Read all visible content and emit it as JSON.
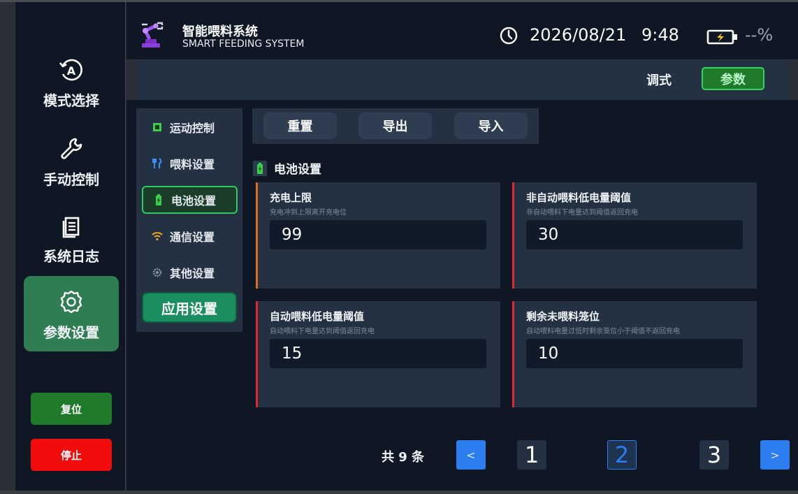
{
  "header": {
    "title": "智能喂料系统",
    "subtitle": "SMART FEEDING SYSTEM",
    "date": "2026/08/21",
    "time": "9:48",
    "battery": "--%"
  },
  "sidebar": {
    "items": [
      {
        "label": "模式选择",
        "icon": "mode-auto-icon"
      },
      {
        "label": "手动控制",
        "icon": "wrench-icon"
      },
      {
        "label": "系统日志",
        "icon": "log-file-icon"
      },
      {
        "label": "参数设置",
        "icon": "gear-icon"
      }
    ],
    "reset_label": "复位",
    "stop_label": "停止"
  },
  "modebar": {
    "debug_label": "调式",
    "param_label": "参数"
  },
  "subnav": {
    "items": [
      {
        "label": "运动控制",
        "icon": "chip-icon"
      },
      {
        "label": "喂料设置",
        "icon": "fork-knife-icon"
      },
      {
        "label": "电池设置",
        "icon": "battery-icon"
      },
      {
        "label": "通信设置",
        "icon": "wifi-icon"
      },
      {
        "label": "其他设置",
        "icon": "cog-icon"
      }
    ],
    "apply_label": "应用设置"
  },
  "toolbar": {
    "reset_label": "重置",
    "export_label": "导出",
    "import_label": "导入"
  },
  "section": {
    "title": "电池设置"
  },
  "cards": [
    {
      "title": "充电上限",
      "desc": "充电冲到上限离开充电位",
      "value": "99"
    },
    {
      "title": "非自动喂料低电量阈值",
      "desc": "非自动喂料下电量达到阈值返回充电",
      "value": "30"
    },
    {
      "title": "自动喂料低电量阈值",
      "desc": "自动喂料下电量达到阈值返回充电",
      "value": "15"
    },
    {
      "title": "剩余未喂料笼位",
      "desc": "自动喂料电量过低时剩余笼位小于阈值不返回充电",
      "value": "10"
    }
  ],
  "pagination": {
    "total": "共 9 条",
    "prev": "<",
    "next": ">",
    "pages": [
      "1",
      "2",
      "3"
    ],
    "current": "2"
  },
  "colors": {
    "accent_green": "#2f7d52",
    "stop_red": "#f20d0d",
    "page_blue": "#2b7df0",
    "card_border_red": "#e5272f",
    "card_border_orange": "#e26b1f"
  }
}
